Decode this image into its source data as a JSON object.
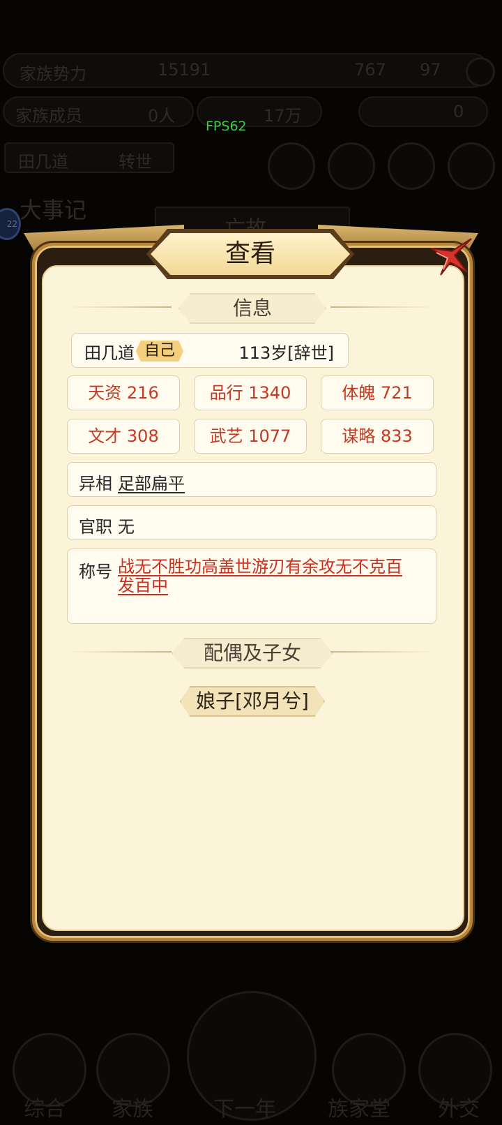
{
  "overlay": {
    "fps_label": "FPS62",
    "side_badge": "22",
    "bg_texts": [
      "家族势力",
      "15191",
      "767",
      "97",
      "家族成员",
      "0人",
      "17万",
      "0",
      "田几道",
      "转世",
      "大事记",
      "亡故"
    ],
    "bottom_nav": [
      "综合",
      "家族",
      "下一年",
      "族家堂",
      "外交"
    ]
  },
  "dialog": {
    "title": "查看",
    "info_section_label": "信息",
    "name": "田几道",
    "self_tag": "自己",
    "age_status": "113岁[辞世]",
    "stats": [
      "天资 216",
      "品行 1340",
      "体魄 721",
      "文才 308",
      "武艺 1077",
      "谋略 833"
    ],
    "trait_label": "异相",
    "trait_value": "足部扁平",
    "office_label": "官职",
    "office_value": "无",
    "titles_label": "称号",
    "titles_value": "战无不胜功高盖世游刃有余攻无不克百发百中",
    "family_section_label": "配偶及子女",
    "spouse_button": "娘子[邓月兮]"
  },
  "colors": {
    "stat_red": "#c33a24",
    "title_red": "#cc2f1d",
    "panel_bg": "#fcf4d9",
    "frame_gold": "#b8863a",
    "close_red": "#d8332a"
  }
}
